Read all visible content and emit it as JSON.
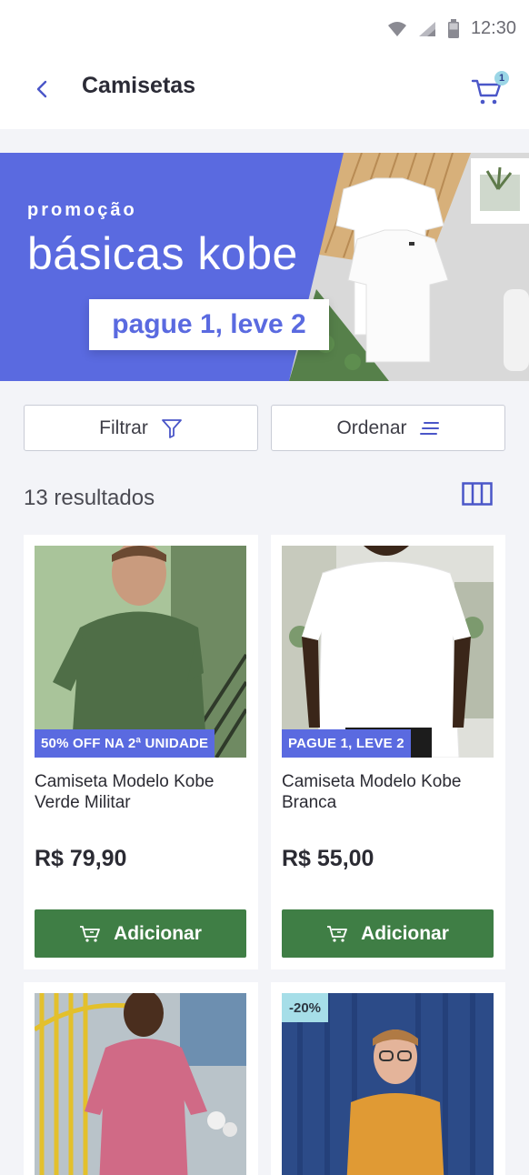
{
  "status_bar": {
    "time": "12:30"
  },
  "app_bar": {
    "title": "Camisetas",
    "cart_count": "1"
  },
  "banner": {
    "kicker": "promoção",
    "title": "básicas kobe",
    "cta": "pague 1, leve 2"
  },
  "toolbar": {
    "filter_label": "Filtrar",
    "sort_label": "Ordenar"
  },
  "results": {
    "count_label": "13 resultados"
  },
  "products": [
    {
      "badge": "50% OFF NA 2ª UNIDADE",
      "name": "Camiseta Modelo Kobe Verde Militar",
      "price": "R$ 79,90",
      "add_label": "Adicionar"
    },
    {
      "badge": "PAGUE 1, LEVE 2",
      "name": "Camiseta Modelo Kobe Branca",
      "price": "R$ 55,00",
      "add_label": "Adicionar"
    },
    {
      "badge": ""
    },
    {
      "badge": "-20%"
    }
  ],
  "colors": {
    "accent": "#5a6ae0",
    "add_button": "#3f7e45",
    "discount_badge": "#a6dee8"
  }
}
